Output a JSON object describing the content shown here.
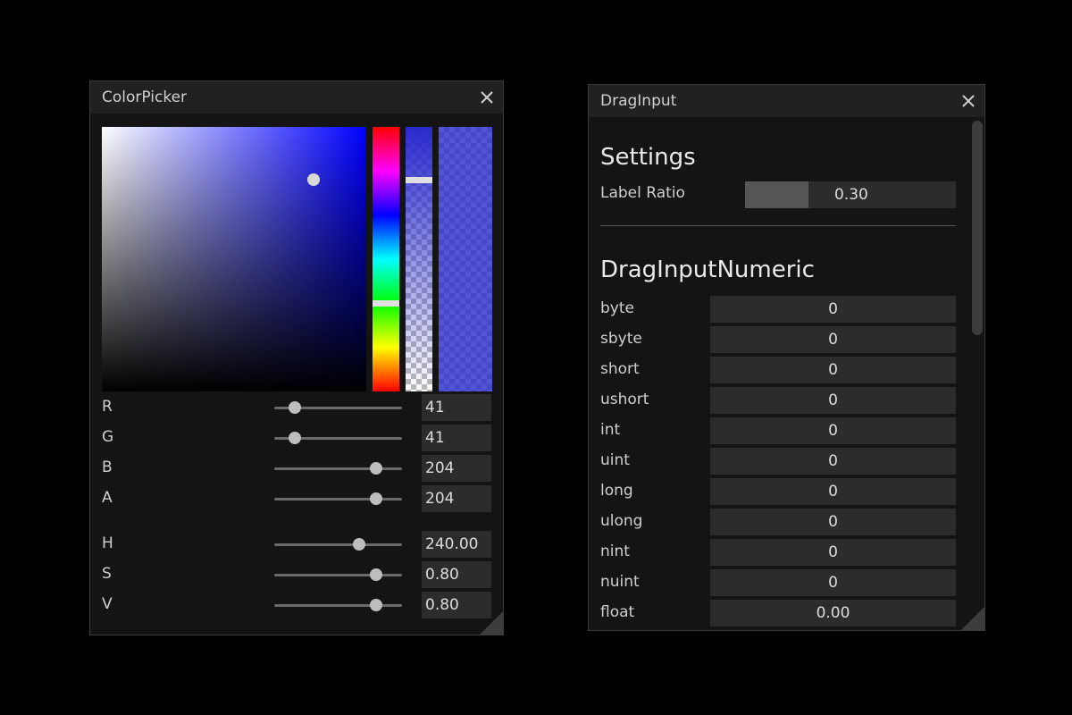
{
  "color_picker": {
    "title": "ColorPicker",
    "selected_color": "#2929cc",
    "hue_degrees": 240,
    "alpha_fraction": 0.8,
    "rgba": [
      {
        "label": "R",
        "value": "41",
        "fraction": 0.16
      },
      {
        "label": "G",
        "value": "41",
        "fraction": 0.16
      },
      {
        "label": "B",
        "value": "204",
        "fraction": 0.8
      },
      {
        "label": "A",
        "value": "204",
        "fraction": 0.8
      }
    ],
    "hsv": [
      {
        "label": "H",
        "value": "240.00",
        "fraction": 0.667
      },
      {
        "label": "S",
        "value": "0.80",
        "fraction": 0.8
      },
      {
        "label": "V",
        "value": "0.80",
        "fraction": 0.8
      }
    ]
  },
  "drag_input": {
    "title": "DragInput",
    "settings_heading": "Settings",
    "label_ratio": {
      "label": "Label Ratio",
      "value": "0.30",
      "fraction": 0.3
    },
    "numeric_heading": "DragInputNumeric",
    "fields": [
      {
        "label": "byte",
        "value": "0"
      },
      {
        "label": "sbyte",
        "value": "0"
      },
      {
        "label": "short",
        "value": "0"
      },
      {
        "label": "ushort",
        "value": "0"
      },
      {
        "label": "int",
        "value": "0"
      },
      {
        "label": "uint",
        "value": "0"
      },
      {
        "label": "long",
        "value": "0"
      },
      {
        "label": "ulong",
        "value": "0"
      },
      {
        "label": "nint",
        "value": "0"
      },
      {
        "label": "nuint",
        "value": "0"
      },
      {
        "label": "float",
        "value": "0.00"
      }
    ]
  },
  "icons": {
    "close": "close-icon",
    "resize": "resize-grip-icon"
  }
}
